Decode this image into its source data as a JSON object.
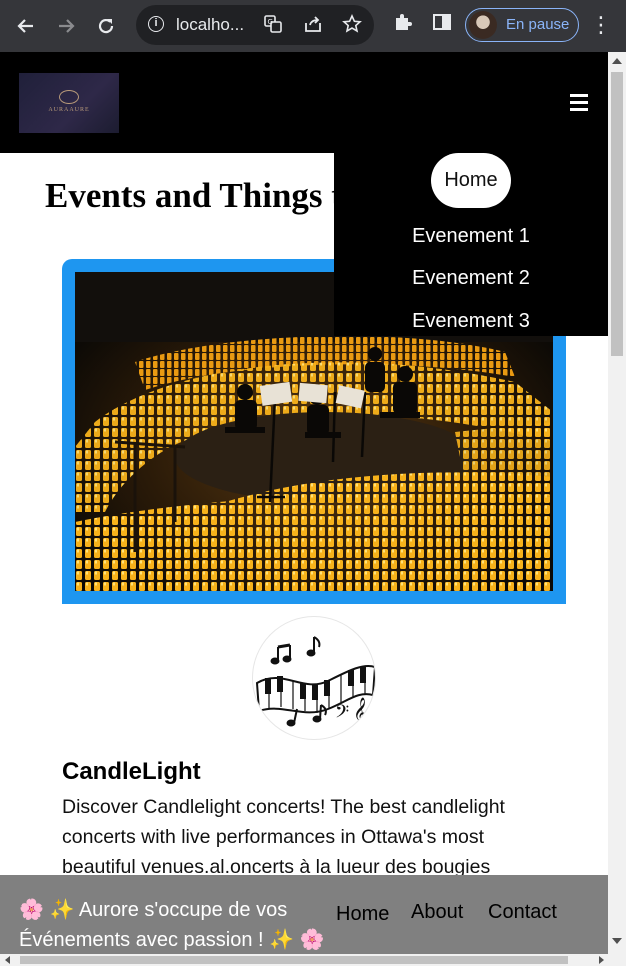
{
  "browser": {
    "url": "localho...",
    "profile_label": "En pause",
    "icons": {
      "back": "back-arrow-icon",
      "forward": "forward-arrow-icon",
      "reload": "reload-icon",
      "info": "site-info-icon",
      "translate": "translate-icon",
      "share": "share-icon",
      "bookmark": "star-icon",
      "extensions": "puzzle-icon",
      "sidepanel": "side-panel-icon",
      "menu": "kebab-menu-icon"
    }
  },
  "site": {
    "logo_text": "AURAAURE",
    "nav": {
      "items": [
        "Home",
        "Evenement 1",
        "Evenement 2",
        "Evenement 3"
      ],
      "active": "Home"
    },
    "page_title": "Events and Things t",
    "event": {
      "title": "CandleLight",
      "description": "Discover Candlelight concerts! The best candlelight concerts with live performances in Ottawa's most beautiful venues.al.oncerts à la lueur des bougies"
    },
    "footer": {
      "tagline": "🌸 ✨ Aurore s'occupe de vos Événements avec passion ! ✨ 🌸",
      "links": [
        "Home",
        "About",
        "Contact"
      ]
    }
  },
  "colors": {
    "header_bg": "#000000",
    "card_border": "#1e96f0",
    "footer_bg": "#808080",
    "chrome_bg": "#35363a",
    "profile_accent": "#8ab4f8"
  }
}
